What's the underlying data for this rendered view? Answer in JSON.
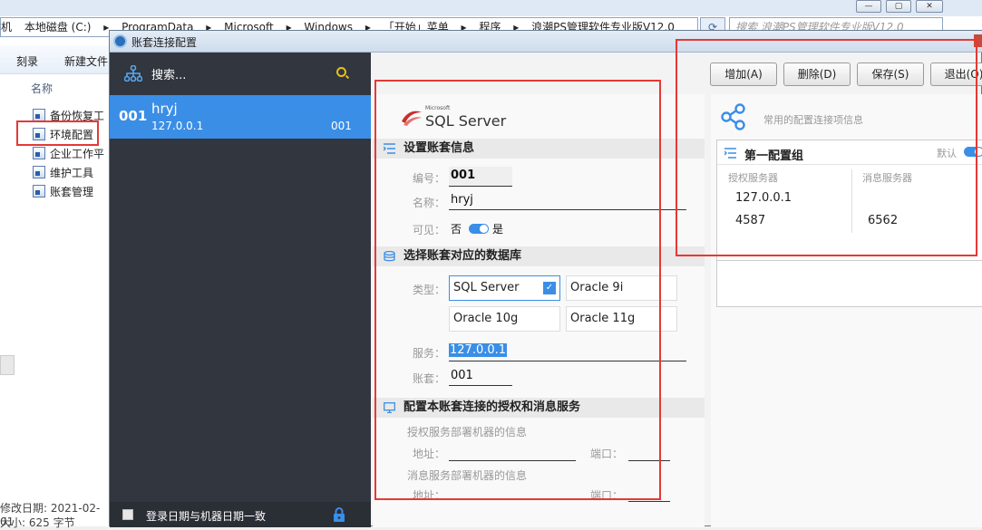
{
  "explorer": {
    "address_parts": [
      "机",
      "本地磁盘 (C:)",
      "▸",
      "ProgramData",
      "▸",
      "Microsoft",
      "▸",
      "Windows",
      "▸",
      "「开始」菜单",
      "▸",
      "程序",
      "▸",
      "浪潮PS管理软件专业版V12.0"
    ],
    "search_placeholder": "搜索 浪潮PS管理软件专业版V12.0",
    "toolbar": {
      "burn": "刻录",
      "new_folder": "新建文件"
    },
    "column_header": "名称",
    "files": [
      {
        "name": "备份恢复工"
      },
      {
        "name": "环境配置"
      },
      {
        "name": "企业工作平"
      },
      {
        "name": "维护工具"
      },
      {
        "name": "账套管理"
      }
    ],
    "status": {
      "modified": "修改日期: 2021-02-01",
      "size": "大小: 625 字节"
    },
    "window_buttons": [
      "—",
      "▢",
      "✕"
    ]
  },
  "dialog": {
    "title": "账套连接配置",
    "sidebar": {
      "search_label": "搜索...",
      "selected_item": {
        "code": "001",
        "name": "hryj",
        "ip": "127.0.0.1",
        "code_right": "001"
      },
      "bottom_checkbox_label": "登录日期与机器日期一致"
    },
    "toolbar": {
      "add": "增加(A)",
      "delete": "删除(D)",
      "save": "保存(S)",
      "exit": "退出(O)"
    },
    "form": {
      "logo_small": "Microsoft",
      "logo": "SQL Server",
      "section_account": "设置账套信息",
      "code_label": "编号：",
      "code_value": "001",
      "name_label": "名称：",
      "name_value": "hryj",
      "visible_label": "可见：",
      "visible_no": "否",
      "visible_yes": "是",
      "section_db": "选择账套对应的数据库",
      "type_label": "类型：",
      "db_options": [
        "SQL Server",
        "Oracle 9i",
        "Oracle 10g",
        "Oracle 11g"
      ],
      "selected_db": "SQL Server",
      "service_label": "服务：",
      "service_value": "127.0.0.1",
      "account_label": "账套：",
      "account_value": "001",
      "section_services": "配置本账套连接的授权和消息服务",
      "auth_info": "授权服务部署机器的信息",
      "msg_info": "消息服务部署机器的信息",
      "addr_label": "地址：",
      "port_label": "端口："
    },
    "right": {
      "subtitle": "常用的配置连接项信息",
      "group_title": "第一配置组",
      "default_label": "默认",
      "auth_server_label": "授权服务器",
      "auth_ip": "127.0.0.1",
      "auth_port": "4587",
      "msg_server_label": "消息服务器",
      "msg_port": "6562"
    }
  },
  "colors": {
    "accent": "#3a8ee6",
    "sidebar": "#31363f",
    "highlight_box": "#e53935"
  }
}
